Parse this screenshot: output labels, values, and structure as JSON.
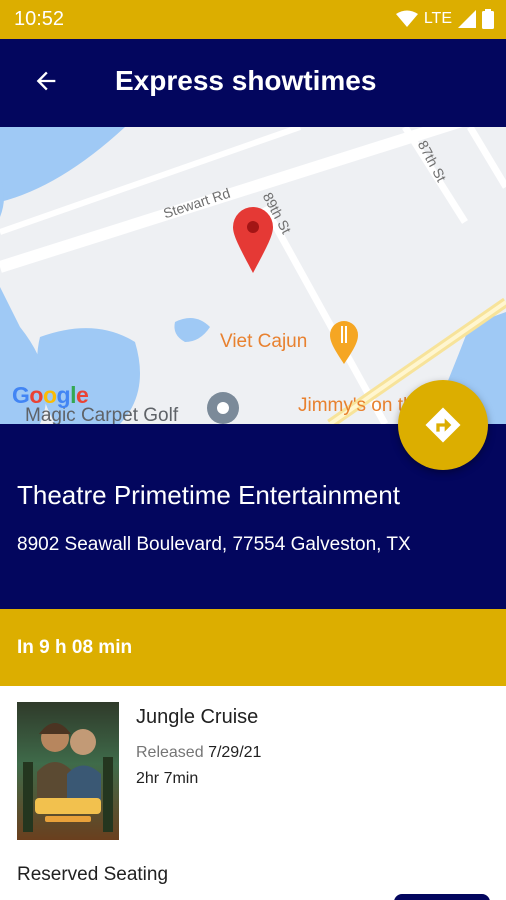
{
  "status_bar": {
    "time": "10:52",
    "network": "LTE"
  },
  "header": {
    "title": "Express showtimes",
    "back_icon": "arrow-back-icon"
  },
  "map": {
    "roads": {
      "stewart": "Stewart Rd",
      "89th": "89th St",
      "87th": "87th St"
    },
    "poi": {
      "viet_cajun": "Viet Cajun",
      "magic_carpet": "Magic Carpet Golf",
      "jimmys": "Jimmy's on the Pier"
    },
    "logo": "Google"
  },
  "theatre": {
    "name": "Theatre Primetime Entertainment",
    "address": "8902 Seawall Boulevard, 77554 Galveston, TX"
  },
  "next_show": {
    "label": "In 9 h 08 min"
  },
  "movie": {
    "title": "Jungle Cruise",
    "released_label": "Released",
    "released_date": "7/29/21",
    "runtime": "2hr 7min",
    "seating": "Reserved Seating"
  },
  "colors": {
    "navy": "#03065e",
    "gold": "#dcae00",
    "pin": "#e53935",
    "water": "#9fc9f5"
  }
}
